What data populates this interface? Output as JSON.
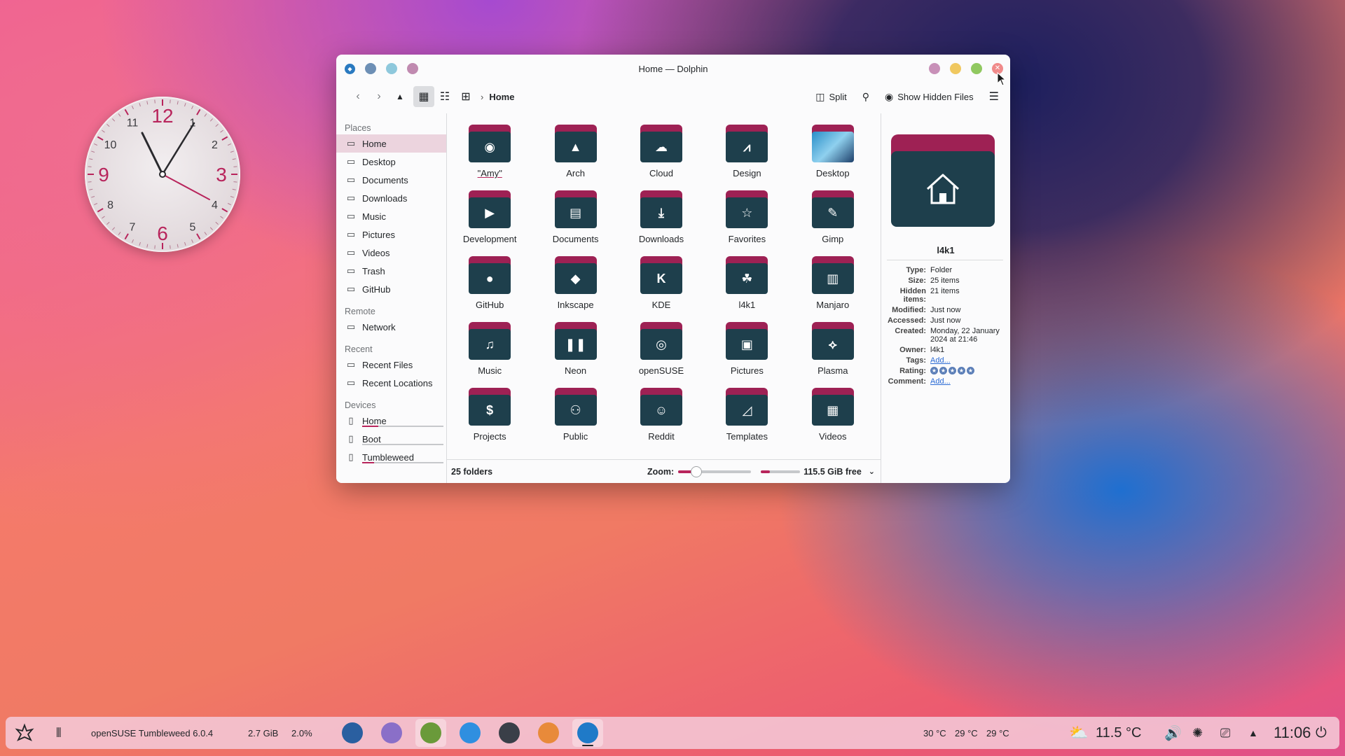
{
  "clock": {
    "numbers": [
      "12",
      "1",
      "2",
      "3",
      "4",
      "5",
      "6",
      "7",
      "8",
      "9",
      "10",
      "11"
    ]
  },
  "window": {
    "title": "Home — Dolphin",
    "toolbar": {
      "breadcrumb": "Home",
      "split_label": "Split",
      "hidden_files_label": "Show Hidden Files"
    },
    "sidebar": {
      "places_header": "Places",
      "places": [
        {
          "label": "Home",
          "icon": "home-icon"
        },
        {
          "label": "Desktop",
          "icon": "desktop-icon"
        },
        {
          "label": "Documents",
          "icon": "document-icon"
        },
        {
          "label": "Downloads",
          "icon": "download-icon"
        },
        {
          "label": "Music",
          "icon": "music-icon"
        },
        {
          "label": "Pictures",
          "icon": "picture-icon"
        },
        {
          "label": "Videos",
          "icon": "video-icon"
        },
        {
          "label": "Trash",
          "icon": "trash-icon"
        },
        {
          "label": "GitHub",
          "icon": "github-icon"
        }
      ],
      "remote_header": "Remote",
      "remote": [
        {
          "label": "Network",
          "icon": "network-icon"
        }
      ],
      "recent_header": "Recent",
      "recent": [
        {
          "label": "Recent Files",
          "icon": "recent-files-icon"
        },
        {
          "label": "Recent Locations",
          "icon": "recent-locations-icon"
        }
      ],
      "devices_header": "Devices",
      "devices": [
        {
          "label": "Home",
          "usage": 0.2
        },
        {
          "label": "Boot",
          "usage": 0.0
        },
        {
          "label": "Tumbleweed",
          "usage": 0.15
        }
      ]
    },
    "folders": [
      {
        "name": "\"Amy\"",
        "glyph": "◉"
      },
      {
        "name": "Arch",
        "glyph": "▲"
      },
      {
        "name": "Cloud",
        "glyph": "☁"
      },
      {
        "name": "Design",
        "glyph": "⩘"
      },
      {
        "name": "Desktop",
        "glyph": ""
      },
      {
        "name": "Development",
        "glyph": "▶"
      },
      {
        "name": "Documents",
        "glyph": "▤"
      },
      {
        "name": "Downloads",
        "glyph": "⤓"
      },
      {
        "name": "Favorites",
        "glyph": "☆"
      },
      {
        "name": "Gimp",
        "glyph": "✎"
      },
      {
        "name": "GitHub",
        "glyph": "●"
      },
      {
        "name": "Inkscape",
        "glyph": "◆"
      },
      {
        "name": "KDE",
        "glyph": "K"
      },
      {
        "name": "l4k1",
        "glyph": "☘"
      },
      {
        "name": "Manjaro",
        "glyph": "▥"
      },
      {
        "name": "Music",
        "glyph": "♫"
      },
      {
        "name": "Neon",
        "glyph": "❚❚"
      },
      {
        "name": "openSUSE",
        "glyph": "◎"
      },
      {
        "name": "Pictures",
        "glyph": "▣"
      },
      {
        "name": "Plasma",
        "glyph": "⟡"
      },
      {
        "name": "Projects",
        "glyph": "$"
      },
      {
        "name": "Public",
        "glyph": "⚇"
      },
      {
        "name": "Reddit",
        "glyph": "☺"
      },
      {
        "name": "Templates",
        "glyph": "◿"
      },
      {
        "name": "Videos",
        "glyph": "▦"
      }
    ],
    "status": {
      "count": "25 folders",
      "zoom_label": "Zoom:",
      "zoom_level": 0.25,
      "disk_used": 0.22,
      "free": "115.5 GiB free"
    },
    "info": {
      "name": "l4k1",
      "props": [
        {
          "k": "Type:",
          "v": "Folder"
        },
        {
          "k": "Size:",
          "v": "25 items"
        },
        {
          "k": "Hidden items:",
          "v": "21 items"
        },
        {
          "k": "Modified:",
          "v": "Just now"
        },
        {
          "k": "Accessed:",
          "v": "Just now"
        },
        {
          "k": "Created:",
          "v": "Monday, 22 January 2024 at 21:46"
        },
        {
          "k": "Owner:",
          "v": "l4k1"
        }
      ],
      "tags_label": "Tags:",
      "tags_value": "Add...",
      "rating_label": "Rating:",
      "rating": 5,
      "comment_label": "Comment:",
      "comment_value": "Add..."
    }
  },
  "taskbar": {
    "os_label": "openSUSE Tumbleweed 6.0.4",
    "memory": "2.7 GiB",
    "cpu": "2.0%",
    "temps": [
      "30 °C",
      "29 °C",
      "29 °C"
    ],
    "weather": "11.5 °C",
    "time": "11:06",
    "accent": "#b8255c"
  }
}
